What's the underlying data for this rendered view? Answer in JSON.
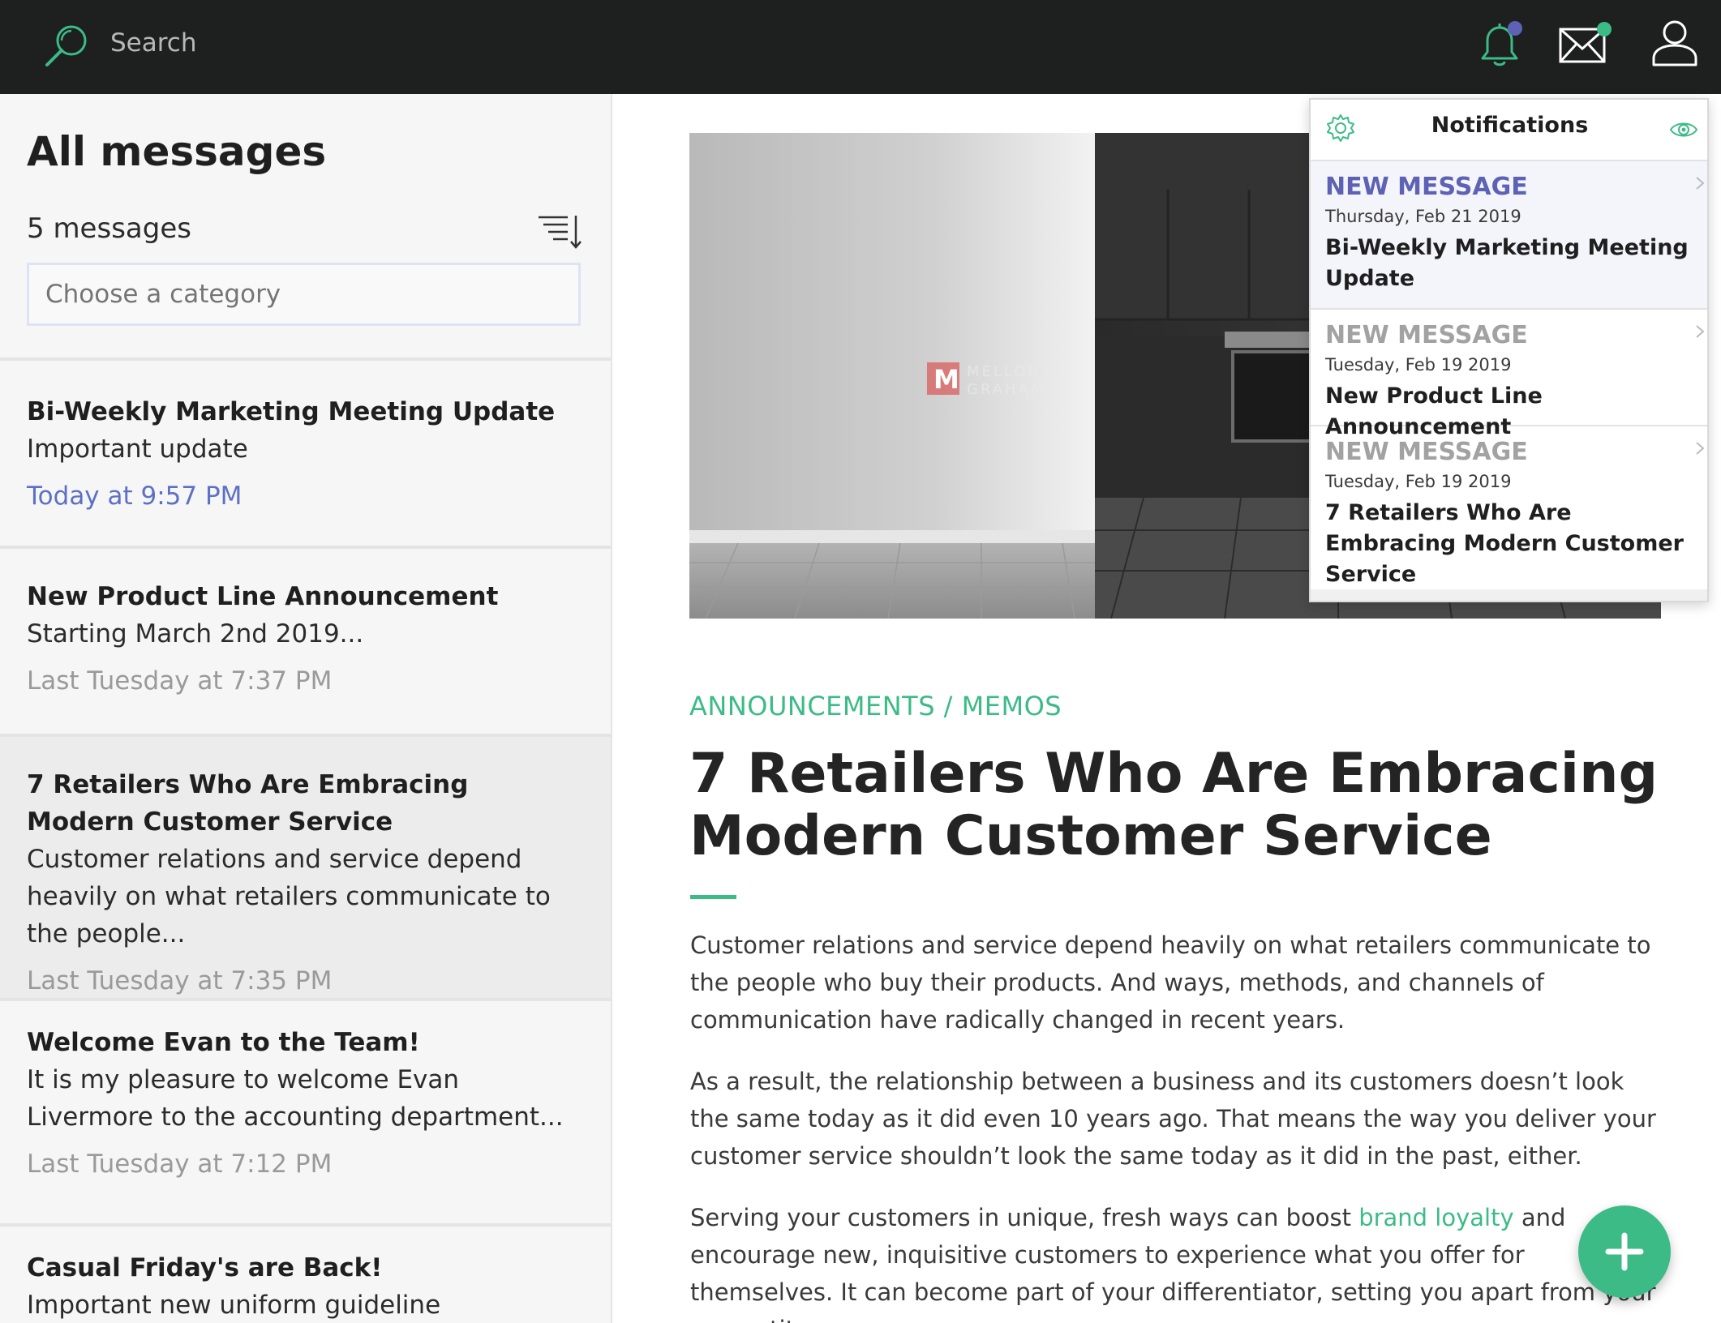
{
  "topbar": {
    "search_placeholder": "Search",
    "icons": [
      "search-icon",
      "bell-icon",
      "mail-icon",
      "user-icon"
    ],
    "bell_badge_color": "#5d62b4",
    "mail_badge_color": "#3cbb87"
  },
  "sidebar": {
    "title": "All messages",
    "count": "5 messages",
    "category_placeholder": "Choose a category",
    "messages": [
      {
        "title": "Bi-Weekly Marketing Meeting Update",
        "preview": "Important update",
        "time": "Today at 9:57 PM"
      },
      {
        "title": "New Product Line Announcement",
        "preview": "Starting March 2nd 2019...",
        "time": "Last Tuesday at 7:37 PM"
      },
      {
        "title": "7 Retailers Who Are Embracing Modern Customer Service",
        "preview": "Customer relations and service depend heavily on what retailers communicate to the people...",
        "time": "Last Tuesday at 7:35 PM"
      },
      {
        "title": "Welcome Evan to the Team!",
        "preview": "It is my pleasure to welcome Evan Livermore to the accounting department...",
        "time": "Last Tuesday at 7:12 PM"
      },
      {
        "title": "Casual Friday's are Back!",
        "preview": "Important new uniform guideline information",
        "time": ""
      }
    ]
  },
  "article": {
    "category": "ANNOUNCEMENTS / MEMOS",
    "title": "7 Retailers Who Are Embracing Modern Customer Service",
    "watermark_line1": "MELLOR",
    "watermark_line2": "GRAHAM",
    "paragraphs": [
      "Customer relations and service depend heavily on what retailers communicate to the people who buy their products. And ways, methods, and channels of communication have radically changed in recent years.",
      "As a result, the relationship between a business and its customers doesn’t look the same today as it did even 10 years ago. That means the way you deliver your customer service shouldn’t look the same today as it did in the past, either."
    ],
    "p3_before": "Serving your customers in unique, fresh ways can boost ",
    "p3_link": "brand loyalty",
    "p3_after": " and encourage new, inquisitive customers to experience what you offer for themselves. It can become part of your differentiator, setting you apart from your competitors.",
    "accent_color": "#3cbb87"
  },
  "notifications": {
    "title": "Notifications",
    "items": [
      {
        "label": "NEW MESSAGE",
        "date": "Thursday, Feb 21 2019",
        "title": "Bi-Weekly Marketing Meeting Update",
        "unread": true
      },
      {
        "label": "NEW MESSAGE",
        "date": "Tuesday, Feb 19 2019",
        "title": "New Product Line Announcement",
        "unread": false
      },
      {
        "label": "NEW MESSAGE",
        "date": "Tuesday, Feb 19 2019",
        "title": "7 Retailers Who Are Embracing Modern Customer Service",
        "unread": false
      }
    ]
  }
}
